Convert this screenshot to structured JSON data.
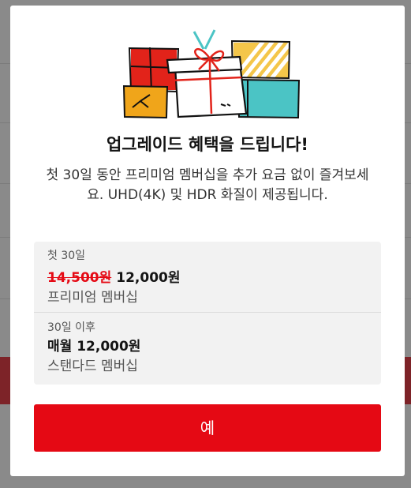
{
  "modal": {
    "title": "업그레이드 혜택을 드립니다!",
    "description": "첫 30일 동안 프리미엄 멤버십을 추가 요금 없이 즐겨보세요. UHD(4K) 및 HDR 화질이 제공됩니다.",
    "first_period": {
      "label": "첫 30일",
      "old_price": "14,500원",
      "new_price": "12,000원",
      "plan": "프리미엄 멤버십"
    },
    "after_period": {
      "label": "30일 이후",
      "price": "매월 12,000원",
      "plan": "스탠다드 멤버십"
    },
    "confirm_label": "예"
  },
  "colors": {
    "accent": "#e50914",
    "overlay": "#8a8a8a",
    "panel": "#f2f2f2"
  },
  "icons": [
    "gift-boxes-illustration"
  ]
}
